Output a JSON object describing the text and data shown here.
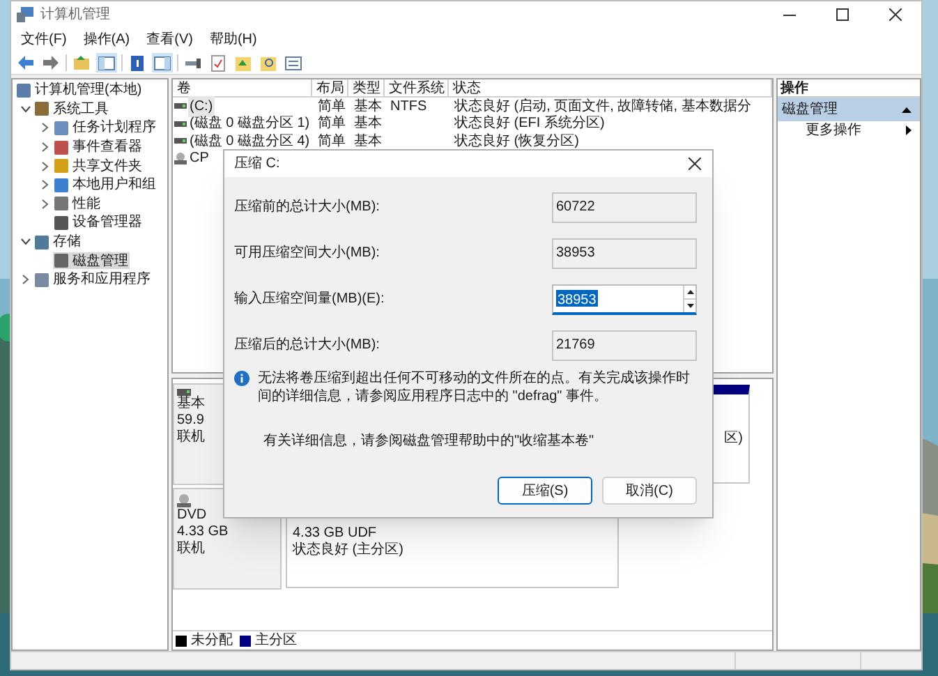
{
  "window": {
    "title": "计算机管理"
  },
  "menu": [
    "文件(F)",
    "操作(A)",
    "查看(V)",
    "帮助(H)"
  ],
  "tree": [
    {
      "label": "计算机管理(本地)",
      "selected": false,
      "children": [
        {
          "label": "系统工具",
          "expanded": true,
          "selected": false,
          "children": [
            {
              "label": "任务计划程序",
              "expanded": false,
              "selected": false
            },
            {
              "label": "事件查看器",
              "expanded": false,
              "selected": false
            },
            {
              "label": "共享文件夹",
              "expanded": false,
              "selected": false
            },
            {
              "label": "本地用户和组",
              "expanded": false,
              "selected": false
            },
            {
              "label": "性能",
              "expanded": false,
              "selected": false
            },
            {
              "label": "设备管理器",
              "selected": false
            }
          ]
        },
        {
          "label": "存储",
          "expanded": true,
          "selected": false,
          "children": [
            {
              "label": "磁盘管理",
              "selected": true
            }
          ]
        },
        {
          "label": "服务和应用程序",
          "expanded": false,
          "selected": false
        }
      ]
    }
  ],
  "volumes": {
    "columns": [
      "卷",
      "布局",
      "类型",
      "文件系统",
      "状态"
    ],
    "rows": [
      {
        "volume": "(C:)",
        "layout": "简单",
        "type": "基本",
        "fs": "NTFS",
        "status": "状态良好 (启动, 页面文件, 故障转储, 基本数据分",
        "selected": true
      },
      {
        "volume": "(磁盘 0 磁盘分区 1)",
        "layout": "简单",
        "type": "基本",
        "status": "状态良好 (EFI 系统分区)",
        "selected": false
      },
      {
        "volume": "(磁盘 0 磁盘分区 4)",
        "layout": "简单",
        "type": "基本",
        "status": "状态良好 (恢复分区)",
        "selected": false
      },
      {
        "volume": "CP",
        "kind": "cdrom",
        "selected": false
      }
    ]
  },
  "disks": [
    {
      "kind": "disk",
      "type": "基本",
      "size": "59.9",
      "state": "联机",
      "partitions": [
        {
          "status": "区)"
        }
      ]
    },
    {
      "kind": "cdrom",
      "type": "DVD",
      "size": "4.33 GB",
      "state": "联机",
      "partitions": [
        {
          "size": "4.33 GB UDF",
          "status": "状态良好 (主分区)"
        }
      ]
    }
  ],
  "legend": [
    {
      "label": "未分配",
      "color": "#000000"
    },
    {
      "label": "主分区",
      "color": "#000080"
    }
  ],
  "actions": {
    "title": "操作",
    "sections": [
      {
        "label": "磁盘管理",
        "expanded": true,
        "items": [
          {
            "label": "更多操作"
          }
        ]
      }
    ]
  },
  "dialog": {
    "title": "压缩 C:",
    "fields": [
      {
        "label": "压缩前的总计大小(MB):",
        "value": "60722",
        "kind": "readonly"
      },
      {
        "label": "可用压缩空间大小(MB):",
        "value": "38953",
        "kind": "readonly"
      },
      {
        "label": "输入压缩空间量(MB)(E):",
        "value": "38953",
        "kind": "spin",
        "text_selected": true
      },
      {
        "label": "压缩后的总计大小(MB):",
        "value": "21769",
        "kind": "readonly"
      }
    ],
    "info": "无法将卷压缩到超出任何不可移动的文件所在的点。有关完成该操作时间的详细信息，请参阅应用程序日志中的 \"defrag\" 事件。",
    "help": "有关详细信息，请参阅磁盘管理帮助中的\"收缩基本卷\"",
    "buttons": [
      {
        "label": "压缩(S)",
        "default": true
      },
      {
        "label": "取消(C)",
        "default": false
      }
    ]
  }
}
